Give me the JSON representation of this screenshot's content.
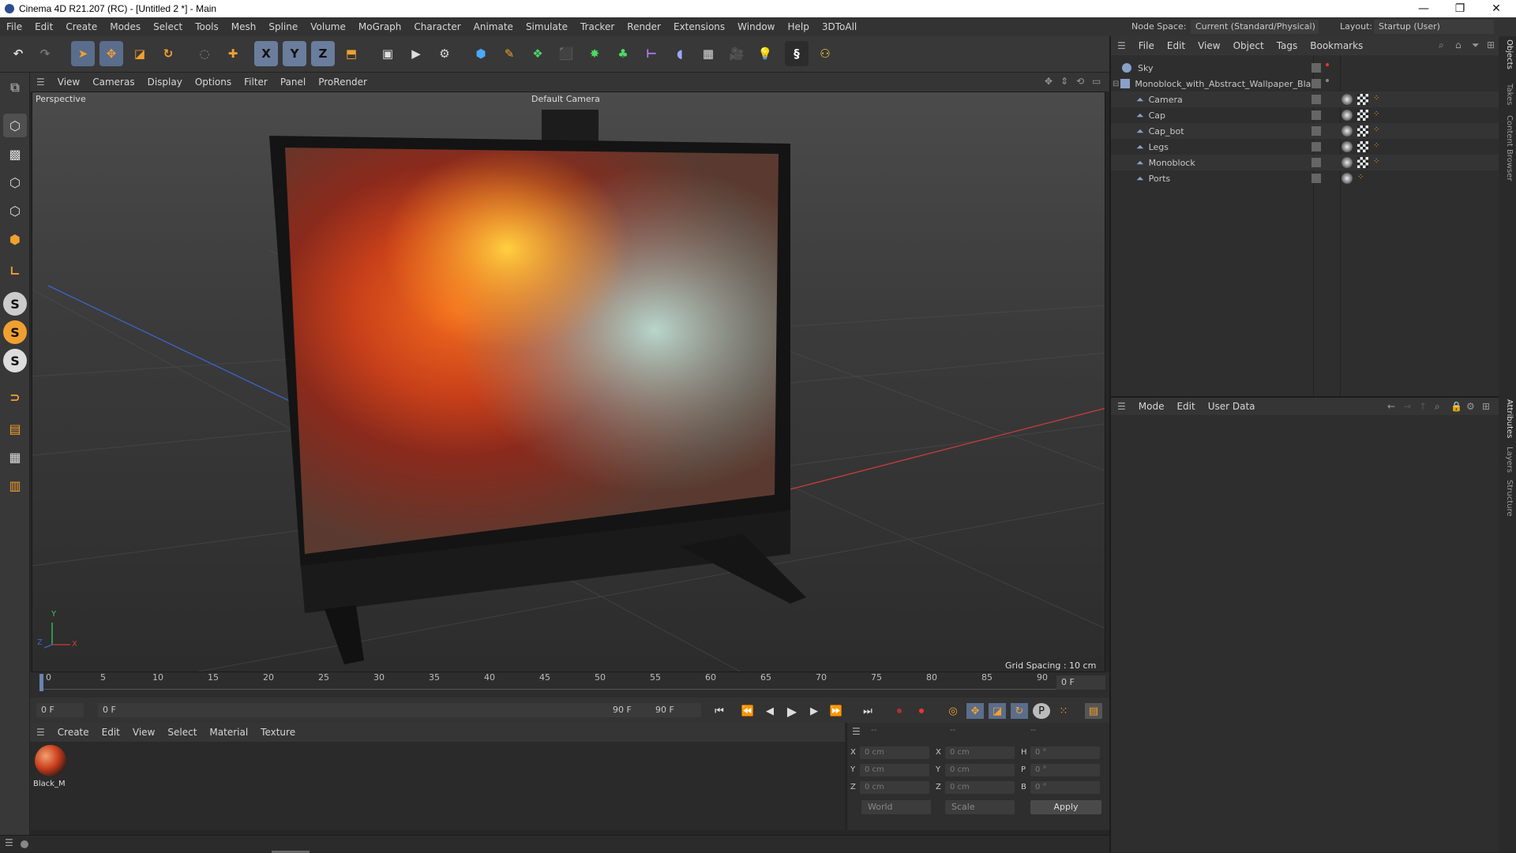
{
  "window": {
    "title": "Cinema 4D R21.207 (RC) - [Untitled 2 *] - Main",
    "minimize": "—",
    "restore": "❐",
    "close": "✕"
  },
  "menu": [
    "File",
    "Edit",
    "Create",
    "Modes",
    "Select",
    "Tools",
    "Mesh",
    "Spline",
    "Volume",
    "MoGraph",
    "Character",
    "Animate",
    "Simulate",
    "Tracker",
    "Render",
    "Extensions",
    "Window",
    "Help",
    "3DToAll"
  ],
  "node_space": {
    "label": "Node Space:",
    "value": "Current (Standard/Physical)"
  },
  "layout": {
    "label": "Layout:",
    "value": "Startup (User)"
  },
  "toolbar": {
    "x_axis": "X",
    "y_axis": "Y",
    "z_axis": "Z"
  },
  "viewport_menu": [
    "View",
    "Cameras",
    "Display",
    "Options",
    "Filter",
    "Panel",
    "ProRender"
  ],
  "viewport": {
    "view_name": "Perspective",
    "camera": "Default Camera",
    "grid_spacing": "Grid Spacing : 10 cm",
    "axis_x": "X",
    "axis_y": "Y",
    "axis_z": "Z"
  },
  "timeline": {
    "ticks": [
      "0",
      "5",
      "10",
      "15",
      "20",
      "25",
      "30",
      "35",
      "40",
      "45",
      "50",
      "55",
      "60",
      "65",
      "70",
      "75",
      "80",
      "85",
      "90"
    ],
    "current_frame": "0 F"
  },
  "transport": {
    "start": "0 F",
    "range_start": "0 F",
    "range_end": "90 F",
    "end": "90 F"
  },
  "material_menu": [
    "Create",
    "Edit",
    "View",
    "Select",
    "Material",
    "Texture"
  ],
  "material": {
    "name": "Black_M"
  },
  "coords": {
    "header_a": "--",
    "header_b": "--",
    "header_c": "--",
    "rows": [
      {
        "a": "X",
        "av": "0 cm",
        "b": "X",
        "bv": "0 cm",
        "c": "H",
        "cv": "0 °"
      },
      {
        "a": "Y",
        "av": "0 cm",
        "b": "Y",
        "bv": "0 cm",
        "c": "P",
        "cv": "0 °"
      },
      {
        "a": "Z",
        "av": "0 cm",
        "b": "Z",
        "bv": "0 cm",
        "c": "B",
        "cv": "0 °"
      }
    ],
    "space": "World",
    "mode": "Scale",
    "apply": "Apply"
  },
  "object_menu": [
    "File",
    "Edit",
    "View",
    "Object",
    "Tags",
    "Bookmarks"
  ],
  "objects": [
    {
      "name": "Sky",
      "level": 0
    },
    {
      "name": "Monoblock_with_Abstract_Wallpaper_Black",
      "level": 0
    },
    {
      "name": "Camera",
      "level": 1
    },
    {
      "name": "Cap",
      "level": 1
    },
    {
      "name": "Cap_bot",
      "level": 1
    },
    {
      "name": "Legs",
      "level": 1
    },
    {
      "name": "Monoblock",
      "level": 1
    },
    {
      "name": "Ports",
      "level": 1
    }
  ],
  "attr_menu": [
    "Mode",
    "Edit",
    "User Data"
  ],
  "side_tabs": [
    "Objects",
    "Takes",
    "Content Browser",
    "Attributes",
    "Layers",
    "Structure"
  ],
  "colors": {
    "accent": "#5a6d8c",
    "bg": "#262626",
    "panel": "#2e2e2e",
    "x_axis": "#c83c3c",
    "y_axis": "#3cc85a",
    "z_axis": "#3c64c8"
  }
}
